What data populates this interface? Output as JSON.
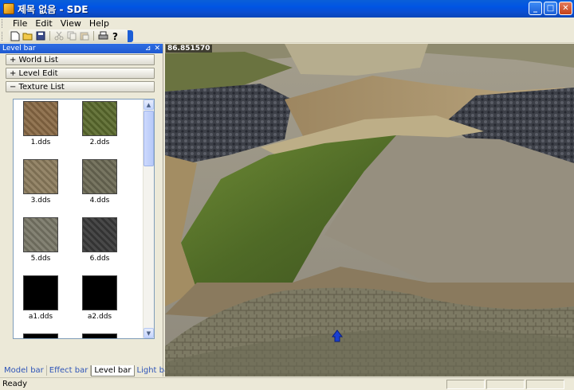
{
  "window": {
    "title": "제목 없음 - SDE"
  },
  "menu": [
    "File",
    "Edit",
    "View",
    "Help"
  ],
  "toolbar": {
    "buttons": [
      "new-icon",
      "open-icon",
      "save-icon",
      "cut-icon",
      "copy-icon",
      "paste-icon",
      "print-icon",
      "help-icon"
    ]
  },
  "panel": {
    "caption": "Level bar",
    "sections": [
      "+ World List",
      "+ Level Edit",
      "− Texture List"
    ],
    "textures": [
      {
        "name": "1.dds",
        "color": "#8a6a45"
      },
      {
        "name": "2.dds",
        "color": "#5b6b2e"
      },
      {
        "name": "3.dds",
        "color": "#8d7d5e"
      },
      {
        "name": "4.dds",
        "color": "#6c6a55"
      },
      {
        "name": "5.dds",
        "color": "#7a7868"
      },
      {
        "name": "6.dds",
        "color": "#3a3a3a"
      },
      {
        "name": "a1.dds",
        "color": "#000000"
      },
      {
        "name": "a2.dds",
        "color": "#000000"
      }
    ]
  },
  "tabs": [
    "Model bar",
    "Effect bar",
    "Level bar",
    "Light bar"
  ],
  "active_tab": "Level bar",
  "viewport": {
    "fps": "86.851570"
  },
  "status": {
    "text": "Ready"
  }
}
